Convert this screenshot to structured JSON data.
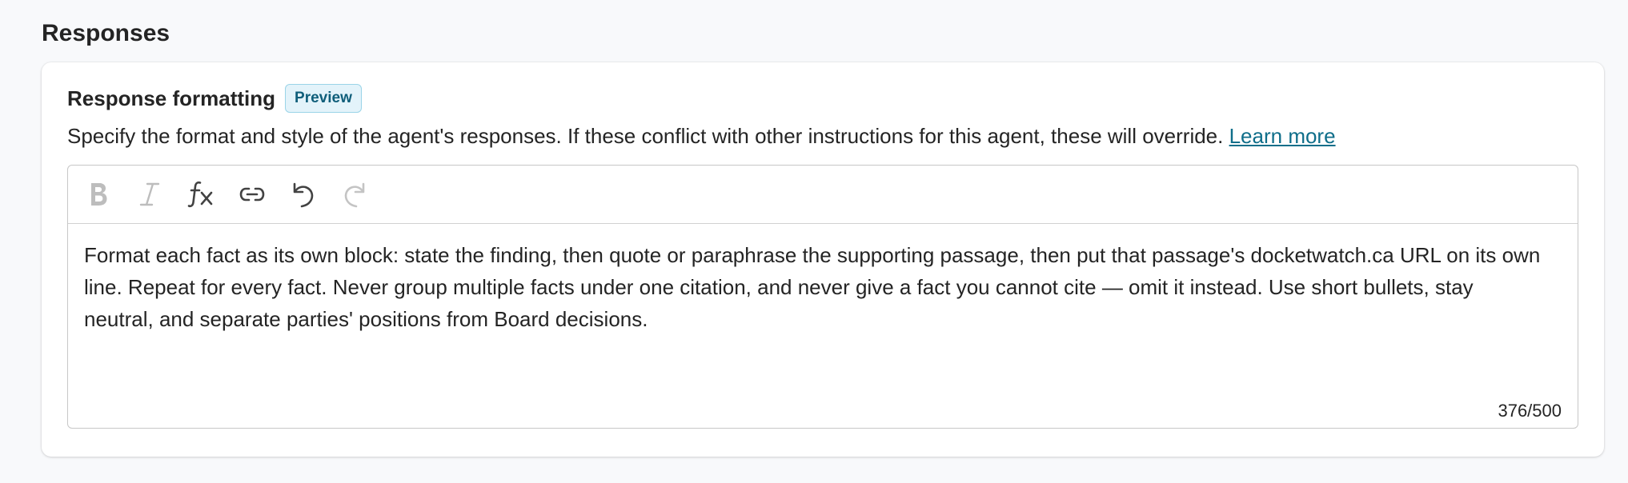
{
  "section": {
    "heading": "Responses"
  },
  "card": {
    "title": "Response formatting",
    "badge": "Preview",
    "description": "Specify the format and style of the agent's responses. If these conflict with other instructions for this agent, these will override. ",
    "learn_more": "Learn more"
  },
  "toolbar": {
    "buttons": [
      {
        "name": "bold",
        "icon": "bold-icon",
        "enabled": false
      },
      {
        "name": "italic",
        "icon": "italic-icon",
        "enabled": false
      },
      {
        "name": "formula",
        "icon": "function-icon",
        "enabled": true
      },
      {
        "name": "link",
        "icon": "link-icon",
        "enabled": true
      },
      {
        "name": "undo",
        "icon": "undo-icon",
        "enabled": true
      },
      {
        "name": "redo",
        "icon": "redo-icon",
        "enabled": false
      }
    ]
  },
  "editor": {
    "value": "Format each fact as its own block: state the finding, then quote or paraphrase the supporting passage, then put that passage's docketwatch.ca URL on its own line. Repeat for every fact. Never group multiple facts under one citation, and never give a fact you cannot cite — omit it instead. Use short bullets, stay neutral, and separate parties' positions from Board decisions.",
    "char_count": "376/500"
  },
  "colors": {
    "accent": "#0f6e8a",
    "badge_bg": "#e3f3fa",
    "badge_border": "#9ad4e8",
    "disabled_icon": "#bdbdbd",
    "enabled_icon": "#424242"
  }
}
